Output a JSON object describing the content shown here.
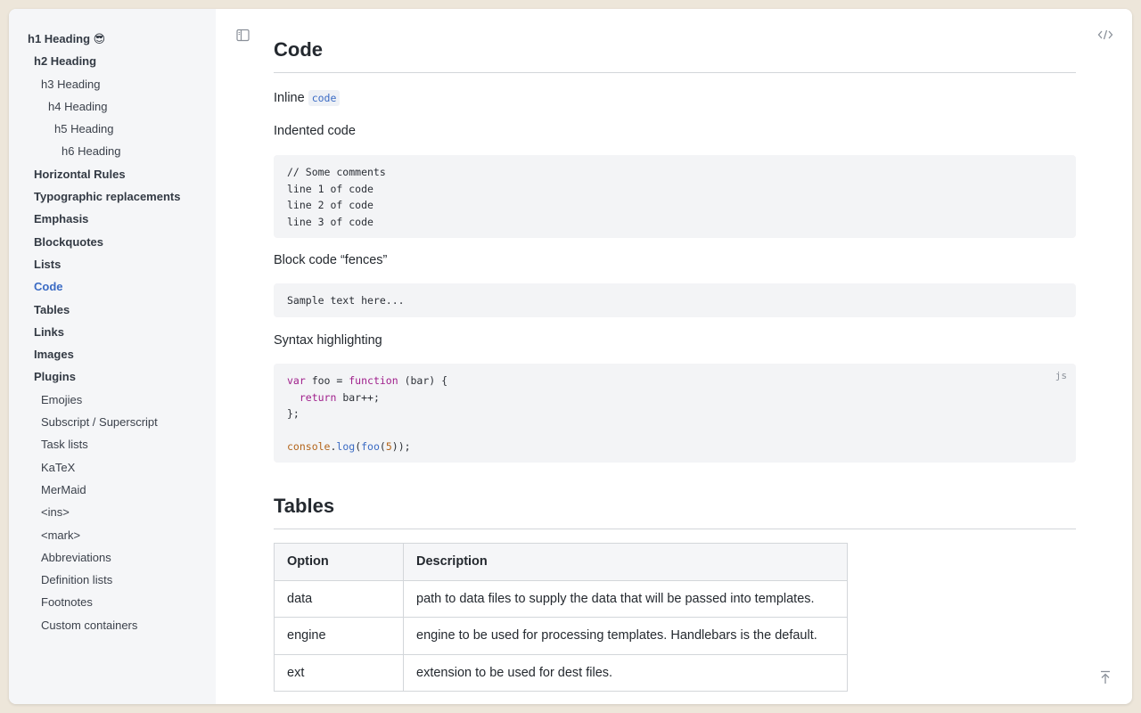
{
  "sidebar": {
    "items": [
      {
        "label": "h1 Heading 😎",
        "level": 0,
        "bold": true,
        "active": false
      },
      {
        "label": "h2 Heading",
        "level": 1,
        "bold": true,
        "active": false
      },
      {
        "label": "h3 Heading",
        "level": 2,
        "bold": false,
        "active": false
      },
      {
        "label": "h4 Heading",
        "level": 3,
        "bold": false,
        "active": false
      },
      {
        "label": "h5 Heading",
        "level": 4,
        "bold": false,
        "active": false
      },
      {
        "label": "h6 Heading",
        "level": 5,
        "bold": false,
        "active": false
      },
      {
        "label": "Horizontal Rules",
        "level": 1,
        "bold": true,
        "active": false
      },
      {
        "label": "Typographic replacements",
        "level": 1,
        "bold": true,
        "active": false
      },
      {
        "label": "Emphasis",
        "level": 1,
        "bold": true,
        "active": false
      },
      {
        "label": "Blockquotes",
        "level": 1,
        "bold": true,
        "active": false
      },
      {
        "label": "Lists",
        "level": 1,
        "bold": true,
        "active": false
      },
      {
        "label": "Code",
        "level": 1,
        "bold": true,
        "active": true
      },
      {
        "label": "Tables",
        "level": 1,
        "bold": true,
        "active": false
      },
      {
        "label": "Links",
        "level": 1,
        "bold": true,
        "active": false
      },
      {
        "label": "Images",
        "level": 1,
        "bold": true,
        "active": false
      },
      {
        "label": "Plugins",
        "level": 1,
        "bold": true,
        "active": false
      },
      {
        "label": "Emojies",
        "level": 2,
        "bold": false,
        "active": false
      },
      {
        "label": "Subscript / Superscript",
        "level": 2,
        "bold": false,
        "active": false
      },
      {
        "label": "Task lists",
        "level": 2,
        "bold": false,
        "active": false
      },
      {
        "label": "KaTeX",
        "level": 2,
        "bold": false,
        "active": false
      },
      {
        "label": "MerMaid",
        "level": 2,
        "bold": false,
        "active": false
      },
      {
        "label": "<ins>",
        "level": 2,
        "bold": false,
        "active": false
      },
      {
        "label": "<mark>",
        "level": 2,
        "bold": false,
        "active": false
      },
      {
        "label": "Abbreviations",
        "level": 2,
        "bold": false,
        "active": false
      },
      {
        "label": "Definition lists",
        "level": 2,
        "bold": false,
        "active": false
      },
      {
        "label": "Footnotes",
        "level": 2,
        "bold": false,
        "active": false
      },
      {
        "label": "Custom containers",
        "level": 2,
        "bold": false,
        "active": false
      }
    ]
  },
  "toolbar": {
    "sidebar_toggle_icon": "sidebar-toggle-icon",
    "source_icon": "code-brackets-icon",
    "scroll_top_icon": "arrow-to-top-icon"
  },
  "code_section": {
    "title": "Code",
    "inline_label": "Inline",
    "inline_code": "code",
    "indented_label": "Indented code",
    "indented_lines": [
      "// Some comments",
      "line 1 of code",
      "line 2 of code",
      "line 3 of code"
    ],
    "fences_label": "Block code “fences”",
    "fences_text": "Sample text here...",
    "syntax_label": "Syntax highlighting",
    "syntax_lang": "js"
  },
  "tables_section": {
    "title": "Tables",
    "headers": [
      "Option",
      "Description"
    ],
    "rows": [
      [
        "data",
        "path to data files to supply the data that will be passed into templates."
      ],
      [
        "engine",
        "engine to be used for processing templates. Handlebars is the default."
      ],
      [
        "ext",
        "extension to be used for dest files."
      ]
    ]
  },
  "colors": {
    "accent": "#3b6bc4",
    "keyword": "#a0208c",
    "sidebar_bg": "#f5f6f8",
    "code_bg": "#f3f4f6"
  }
}
